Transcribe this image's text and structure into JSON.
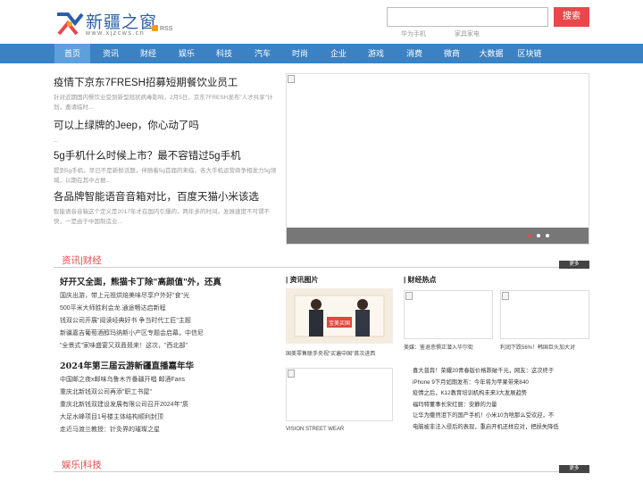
{
  "header": {
    "logo_text": "新疆之窗",
    "logo_url": "www.xjzcws.cn",
    "rss": "RSS",
    "search_placeholder": "",
    "search_button": "搜索",
    "hot_links": [
      "华为手机",
      "家具家电"
    ]
  },
  "nav": [
    "首页",
    "资讯",
    "财经",
    "娱乐",
    "科技",
    "汽车",
    "时尚",
    "企业",
    "游戏",
    "消费",
    "微商",
    "大数据",
    "区块链"
  ],
  "top_news": [
    {
      "title": "疫情下京东7FRESH招募短期餐饮业员工",
      "desc": "针对近期国内餐饮业受到新型冠状病毒影响，2月5日，京东7FRESH发布\"人才共享\"计划，邀请临时..."
    },
    {
      "title": "可以上绿牌的Jeep，你心动了吗",
      "desc": "..."
    },
    {
      "title": "5g手机什么时候上市？最不容错过5g手机",
      "desc": "提到5g手机，早已不是新鲜话题，伴随着5g首届的来临，各大手机运营商争相发力5g领域，以期在其中占据..."
    },
    {
      "title": "各品牌智能语音音箱对比，百度天猫小米该选",
      "desc": "智能语音音箱这个定义是2017年才在国内引爆的，两年多的时间，发展速度不可谓不快，一是由于中国制造业..."
    }
  ],
  "finance": {
    "section_title": "资讯|财经",
    "more": "更多",
    "lead1": "好开又全面，熊猫卡丁除\"高颜值\"外，还真",
    "links1": [
      "国庆出游，带上元祖烘焙美味尽享户外好\"食\"光",
      "500平米大师胜利会龙.通途畅达启新程",
      "钱双公司开展\"阅读经典好书 争当时代工匠\"主题",
      "新疆嘉吉葡萄酒醇玛纳斯小产区专题会启幕，中信尼",
      "\"全景式\"家味盛宴又双叒叕来！这次，\"西北部\""
    ],
    "lead2": "2024年第三届云游新疆直播嘉年华",
    "links2": [
      "中国邮之夜x邮味乌鲁木齐番疆开唱 邮酒Fans",
      "重庆北新钱双公司再添\"职工书屋\"",
      "重庆北新钱双建设发展有限公司召开2024年\"质",
      "大足水峰项目1号楼主体结构顺利封顶",
      "走近马渡兰教授：针灸界的璀璨之星"
    ],
    "pic_head": "| 资讯图片",
    "pic_caption1": "国美零售联手央视\"买遍中国\"首次进西",
    "pic_caption2": "VISION STREET WEAR",
    "photo_text": "宝美买国",
    "hot_head": "| 财经热点",
    "hot_caption1": "美媒：鉴退悲惧正潜入华尔街",
    "hot_caption2": "利润下跌56%！韩国巨头加大对",
    "hot_lines": [
      "喜大普奔！荣耀20青春版价格跌破千元，网友：这次终于",
      "iPhone 9下月如期发布：今年将为苹果带来840",
      "疫情之后，K12教育培训机构未来3大发展趋势",
      "福玛特董事长宋红丽：安静的力量",
      "让华为撒然泪下的国产手机！小米10为啥那么受欢迎，不",
      "电脑被非法入侵后的表现，重启开机还样应对，把损失降低"
    ]
  },
  "ent": {
    "section_title": "娱乐|科技",
    "more": "更多"
  }
}
